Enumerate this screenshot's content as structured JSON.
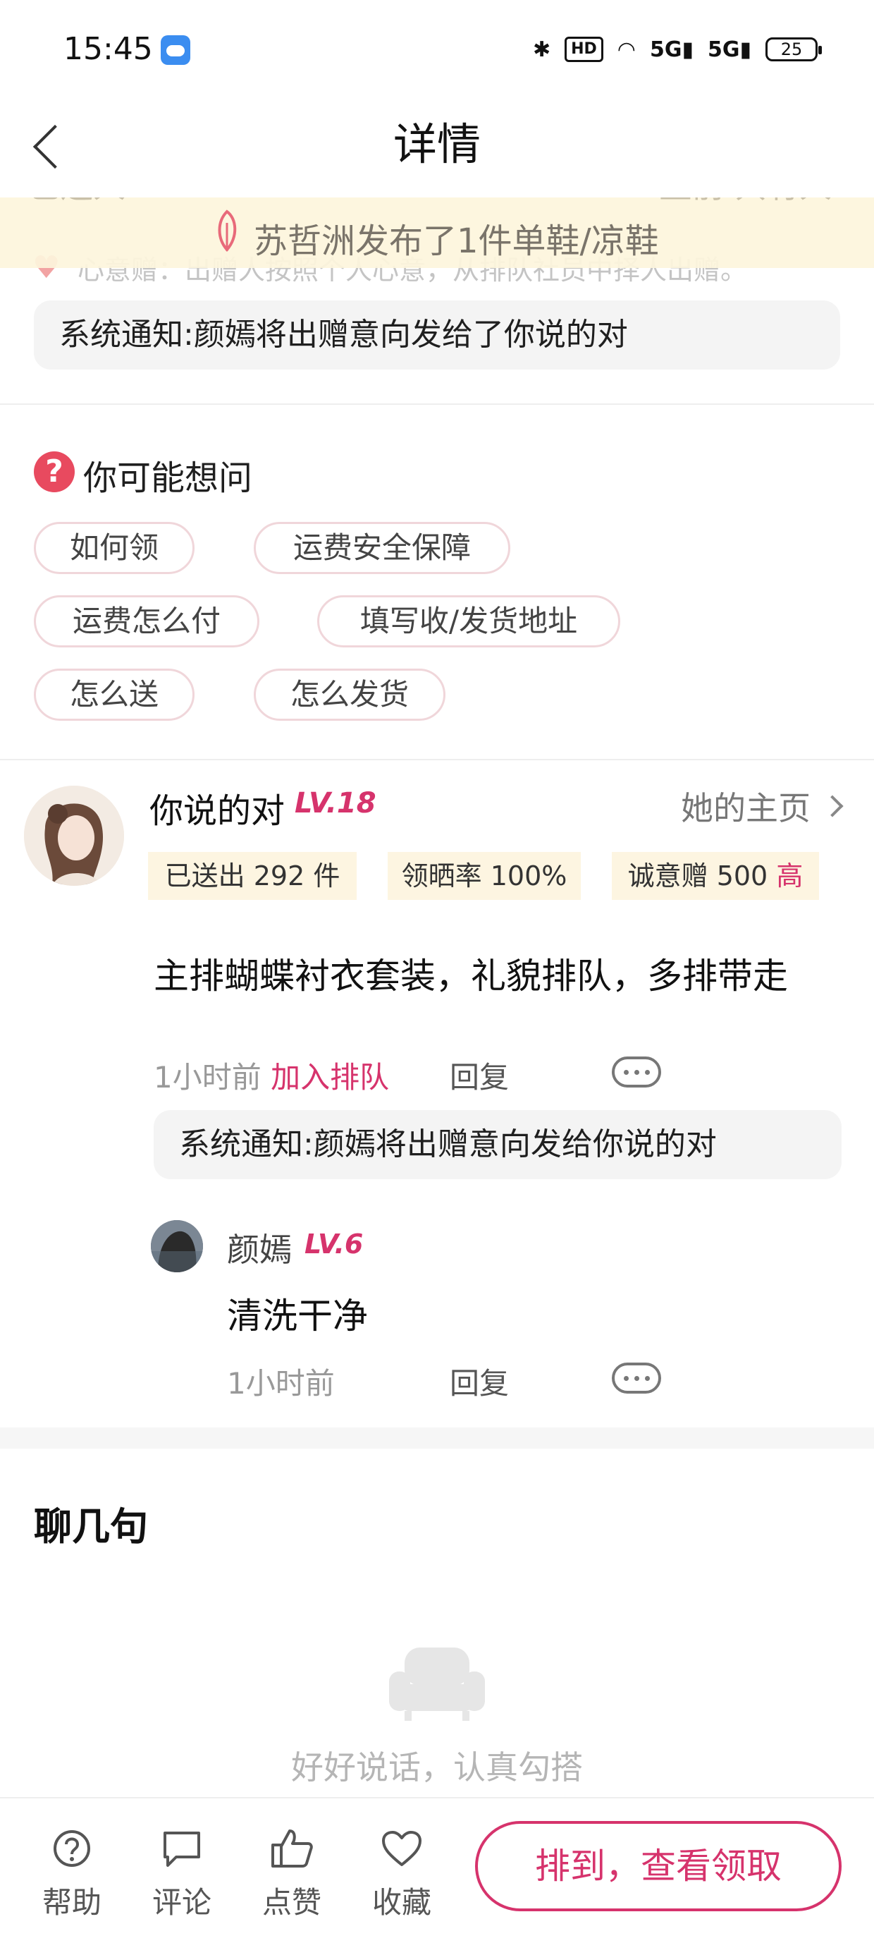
{
  "status_bar": {
    "time": "15:45",
    "hd": "HD",
    "net1": "5G",
    "net2": "5G",
    "battery": "25"
  },
  "nav": {
    "title": "详情"
  },
  "notice_banner": {
    "text": "苏哲洲发布了1件单鞋/凉鞋",
    "behind_left": "已送人",
    "behind_right": "益前 共有人"
  },
  "wish": {
    "text": "心意赠：出赠人按照个人心意，从排队社员中择人出赠。"
  },
  "top_system_notice": "系统通知:颜嫣将出赠意向发给了你说的对",
  "faq": {
    "title": "你可能想问",
    "chips": [
      "如何领",
      "运费安全保障",
      "运费怎么付",
      "填写收/发货地址",
      "怎么送",
      "怎么发货"
    ]
  },
  "post": {
    "username": "你说的对",
    "level": "LV.18",
    "homepage_link": "她的主页",
    "stats": {
      "sent": "已送出 292 件",
      "share_rate": "领晒率 100%",
      "sincerity": "诚意赠 500",
      "sincerity_mark": "高"
    },
    "content": "主排蝴蝶衬衣套装，礼貌排队，多排带走",
    "time": "1小时前",
    "join_queue": "加入排队",
    "reply": "回复",
    "system_notice": "系统通知:颜嫣将出赠意向发给你说的对"
  },
  "reply_comment": {
    "username": "颜嫣",
    "level": "LV.6",
    "content": "清洗干净",
    "time": "1小时前",
    "reply": "回复"
  },
  "chat": {
    "title": "聊几句",
    "empty_text": "好好说话，认真勾搭"
  },
  "bottom_bar": {
    "help": "帮助",
    "comment": "评论",
    "like": "点赞",
    "favorite": "收藏",
    "claim_button": "排到，查看领取"
  },
  "colors": {
    "accent": "#d6336c",
    "banner_bg": "#fdf5e1",
    "faq_icon": "#e84a5f"
  }
}
